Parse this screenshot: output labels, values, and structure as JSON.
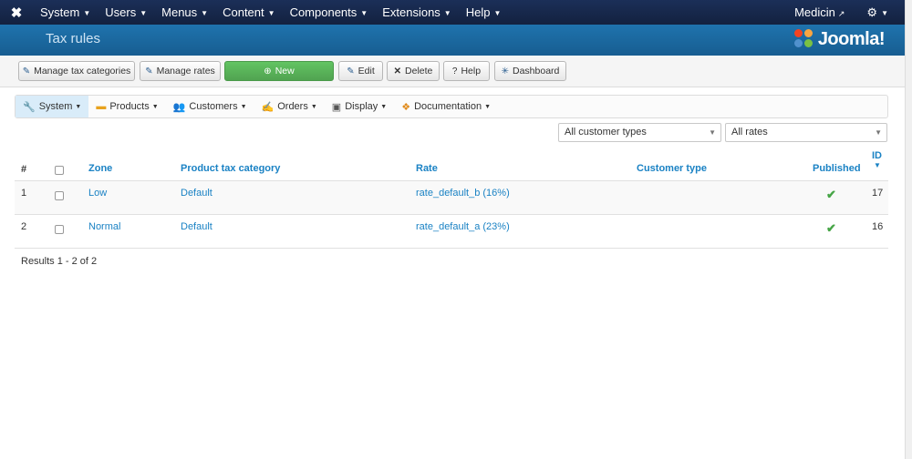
{
  "topnav": {
    "menu": [
      {
        "label": "System"
      },
      {
        "label": "Users"
      },
      {
        "label": "Menus"
      },
      {
        "label": "Content"
      },
      {
        "label": "Components"
      },
      {
        "label": "Extensions"
      },
      {
        "label": "Help"
      }
    ],
    "user_label": "Medicin"
  },
  "header": {
    "title": "Tax rules",
    "brand": "Joomla!"
  },
  "toolbar": {
    "manage_tax_categories": "Manage tax categories",
    "manage_rates": "Manage rates",
    "new": "New",
    "edit": "Edit",
    "delete": "Delete",
    "help": "Help",
    "dashboard": "Dashboard"
  },
  "submenu": [
    {
      "label": "System",
      "icon": "wrench-icon"
    },
    {
      "label": "Products",
      "icon": "box-icon"
    },
    {
      "label": "Customers",
      "icon": "users-icon"
    },
    {
      "label": "Orders",
      "icon": "orders-icon"
    },
    {
      "label": "Display",
      "icon": "display-icon"
    },
    {
      "label": "Documentation",
      "icon": "documentation-icon"
    }
  ],
  "filters": {
    "customer_type": "All customer types",
    "rates": "All rates"
  },
  "table": {
    "headers": {
      "hash": "#",
      "zone": "Zone",
      "category": "Product tax category",
      "rate": "Rate",
      "customer_type": "Customer type",
      "published": "Published",
      "id": "ID"
    },
    "rows": [
      {
        "num": "1",
        "zone": "Low",
        "category": "Default",
        "rate": "rate_default_b (16%)",
        "customer_type": "",
        "published": true,
        "id": "17"
      },
      {
        "num": "2",
        "zone": "Normal",
        "category": "Default",
        "rate": "rate_default_a (23%)",
        "customer_type": "",
        "published": true,
        "id": "16"
      }
    ]
  },
  "results": "Results 1 - 2 of 2"
}
